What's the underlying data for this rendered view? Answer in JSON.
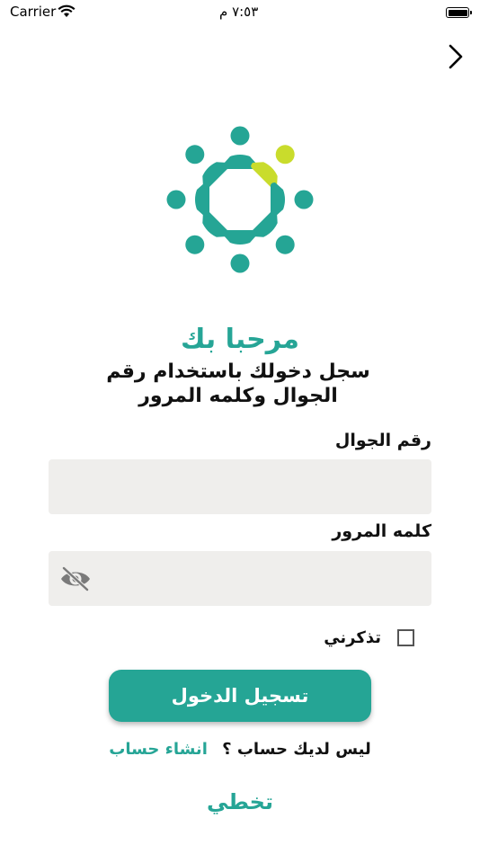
{
  "status_bar": {
    "carrier": "Carrier",
    "time": "٧:٥٣ م"
  },
  "icons": {
    "wifi": "wifi-icon",
    "battery": "battery-icon",
    "back": "chevron-right-icon",
    "eye": "eye-off-icon",
    "logo": "people-circle-logo"
  },
  "colors": {
    "primary": "#25a595",
    "accent": "#c9dc2c",
    "input_bg": "#efeeec"
  },
  "welcome": {
    "title": "مرحبا بك",
    "subtitle": "سجل دخولك باستخدام رقم الجوال وكلمه المرور"
  },
  "form": {
    "phone_label": "رقم الجوال",
    "phone_value": "",
    "password_label": "كلمه المرور",
    "password_value": "",
    "remember_label": "تذكرني"
  },
  "actions": {
    "login": "تسجيل الدخول",
    "no_account": "ليس لديك حساب ؟",
    "create_account": "انشاء حساب",
    "skip": "تخطي"
  }
}
